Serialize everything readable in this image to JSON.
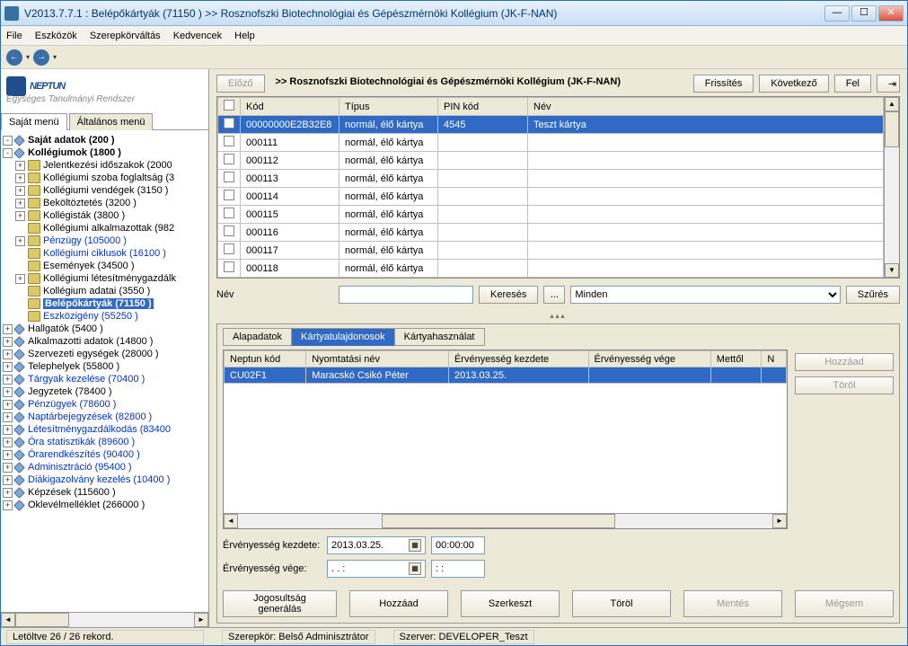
{
  "title": "V2013.7.7.1 : Belépőkártyák (71150  )   >> Rosznofszki Biotechnológiai és Gépészmérnöki Kollégium (JK-F-NAN)",
  "menu": [
    "File",
    "Eszközök",
    "Szerepkörváltás",
    "Kedvencek",
    "Help"
  ],
  "logo": {
    "main": "NEPTUN",
    "sub": "Egységes Tanulmányi Rendszer"
  },
  "left_tabs": [
    "Saját menü",
    "Általános menü"
  ],
  "tree": [
    {
      "ind": 0,
      "exp": "-",
      "ico": "d",
      "label": "Saját adatok (200  )",
      "style": "bold"
    },
    {
      "ind": 0,
      "exp": "-",
      "ico": "d",
      "label": "Kollégiumok (1800  )",
      "style": "bold"
    },
    {
      "ind": 1,
      "exp": "+",
      "ico": "f",
      "label": "Jelentkezési időszakok (2000"
    },
    {
      "ind": 1,
      "exp": "+",
      "ico": "f",
      "label": "Kollégiumi szoba foglaltság (3"
    },
    {
      "ind": 1,
      "exp": "+",
      "ico": "f",
      "label": "Kollégiumi vendégek (3150  )"
    },
    {
      "ind": 1,
      "exp": "+",
      "ico": "f",
      "label": "Beköltöztetés (3200  )"
    },
    {
      "ind": 1,
      "exp": "+",
      "ico": "f",
      "label": "Kollégisták (3800  )"
    },
    {
      "ind": 1,
      "exp": " ",
      "ico": "f",
      "label": "Kollégiumi alkalmazottak (982"
    },
    {
      "ind": 1,
      "exp": "+",
      "ico": "f",
      "label": "Pénzügy (105000  )",
      "style": "blue"
    },
    {
      "ind": 1,
      "exp": " ",
      "ico": "f",
      "label": "Kollégiumi ciklusok (16100  )",
      "style": "blue"
    },
    {
      "ind": 1,
      "exp": " ",
      "ico": "f",
      "label": "Események (34500  )"
    },
    {
      "ind": 1,
      "exp": "+",
      "ico": "f",
      "label": "Kollégiumi létesítménygazdálk"
    },
    {
      "ind": 1,
      "exp": " ",
      "ico": "f",
      "label": "Kollégium adatai (3550  )"
    },
    {
      "ind": 1,
      "exp": " ",
      "ico": "f",
      "label": "Belépőkártyák (71150  )",
      "style": "sel"
    },
    {
      "ind": 1,
      "exp": " ",
      "ico": "f",
      "label": "Eszközigény (55250  )",
      "style": "blue"
    },
    {
      "ind": 0,
      "exp": "+",
      "ico": "d",
      "label": "Hallgatók (5400  )"
    },
    {
      "ind": 0,
      "exp": "+",
      "ico": "d",
      "label": "Alkalmazotti adatok (14800  )"
    },
    {
      "ind": 0,
      "exp": "+",
      "ico": "d",
      "label": "Szervezeti egységek (28000  )"
    },
    {
      "ind": 0,
      "exp": "+",
      "ico": "d",
      "label": "Telephelyek (55800  )"
    },
    {
      "ind": 0,
      "exp": "+",
      "ico": "d",
      "label": "Tárgyak kezelése (70400  )",
      "style": "blue"
    },
    {
      "ind": 0,
      "exp": "+",
      "ico": "d",
      "label": "Jegyzetek (78400  )"
    },
    {
      "ind": 0,
      "exp": "+",
      "ico": "d",
      "label": "Pénzügyek (78600  )",
      "style": "blue"
    },
    {
      "ind": 0,
      "exp": "+",
      "ico": "d",
      "label": "Naptárbejegyzések (82800  )",
      "style": "blue"
    },
    {
      "ind": 0,
      "exp": "+",
      "ico": "d",
      "label": "Létesítménygazdálkodás (83400",
      "style": "blue"
    },
    {
      "ind": 0,
      "exp": "+",
      "ico": "d",
      "label": "Óra statisztikák (89600  )",
      "style": "blue"
    },
    {
      "ind": 0,
      "exp": "+",
      "ico": "d",
      "label": "Órarendkészítés (90400  )",
      "style": "blue"
    },
    {
      "ind": 0,
      "exp": "+",
      "ico": "d",
      "label": "Adminisztráció (95400  )",
      "style": "blue"
    },
    {
      "ind": 0,
      "exp": "+",
      "ico": "d",
      "label": "Diákigazolvány kezelés (10400  )",
      "style": "blue"
    },
    {
      "ind": 0,
      "exp": "+",
      "ico": "d",
      "label": "Képzések (115600  )"
    },
    {
      "ind": 0,
      "exp": "+",
      "ico": "d",
      "label": "Oklevélmelléklet (266000  )"
    }
  ],
  "top": {
    "prev": "Előző",
    "breadcrumb": ">> Rosznofszki Biotechnológiai és Gépészmérnöki Kollégium (JK-F-NAN)",
    "refresh": "Frissítés",
    "next": "Következő",
    "up": "Fel"
  },
  "grid": {
    "headers": [
      "",
      "Kód",
      "Típus",
      "PIN kód",
      "Név"
    ],
    "rows": [
      {
        "sel": true,
        "kod": "00000000E2B32E8",
        "tipus": "normál, élő kártya",
        "pin": "4545",
        "nev": "Teszt kártya"
      },
      {
        "sel": false,
        "kod": "000111",
        "tipus": "normál, élő kártya",
        "pin": "",
        "nev": ""
      },
      {
        "sel": false,
        "kod": "000112",
        "tipus": "normál, élő kártya",
        "pin": "",
        "nev": ""
      },
      {
        "sel": false,
        "kod": "000113",
        "tipus": "normál, élő kártya",
        "pin": "",
        "nev": ""
      },
      {
        "sel": false,
        "kod": "000114",
        "tipus": "normál, élő kártya",
        "pin": "",
        "nev": ""
      },
      {
        "sel": false,
        "kod": "000115",
        "tipus": "normál, élő kártya",
        "pin": "",
        "nev": ""
      },
      {
        "sel": false,
        "kod": "000116",
        "tipus": "normál, élő kártya",
        "pin": "",
        "nev": ""
      },
      {
        "sel": false,
        "kod": "000117",
        "tipus": "normál, élő kártya",
        "pin": "",
        "nev": ""
      },
      {
        "sel": false,
        "kod": "000118",
        "tipus": "normál, élő kártya",
        "pin": "",
        "nev": ""
      }
    ]
  },
  "filter": {
    "label": "Név",
    "search": "Keresés",
    "browse": "...",
    "combo": "Minden",
    "apply": "Szűrés"
  },
  "detail_tabs": [
    "Alapadatok",
    "Kártyatulajdonosok",
    "Kártyahasználat"
  ],
  "detail_grid": {
    "headers": [
      "Neptun kód",
      "Nyomtatási név",
      "Érvényesség kezdete",
      "Érvényesség vége",
      "Mettől",
      "N"
    ],
    "row": {
      "neptun": "CU02F1",
      "nev": "Maracskó Csikó Péter",
      "kezd": "2013.03.25.",
      "vege": "",
      "mettol": ""
    }
  },
  "side_btns": {
    "add": "Hozzáad",
    "del": "Töröl"
  },
  "form": {
    "kezd_label": "Érvényesség kezdete:",
    "kezd_date": "2013.03.25.",
    "kezd_time": "00:00:00",
    "vege_label": "Érvényesség vége:",
    "vege_date": ". . :",
    "vege_time": ": :"
  },
  "bottom_btns": [
    "Jogosultság generálás",
    "Hozzáad",
    "Szerkeszt",
    "Töröl",
    "Mentés",
    "Mégsem"
  ],
  "bottom_disabled": [
    false,
    false,
    false,
    false,
    true,
    true
  ],
  "status": {
    "left": "Letöltve 26 / 26 rekord.",
    "role": "Szerepkör: Belső Adminisztrátor",
    "server": "Szerver: DEVELOPER_Teszt"
  }
}
